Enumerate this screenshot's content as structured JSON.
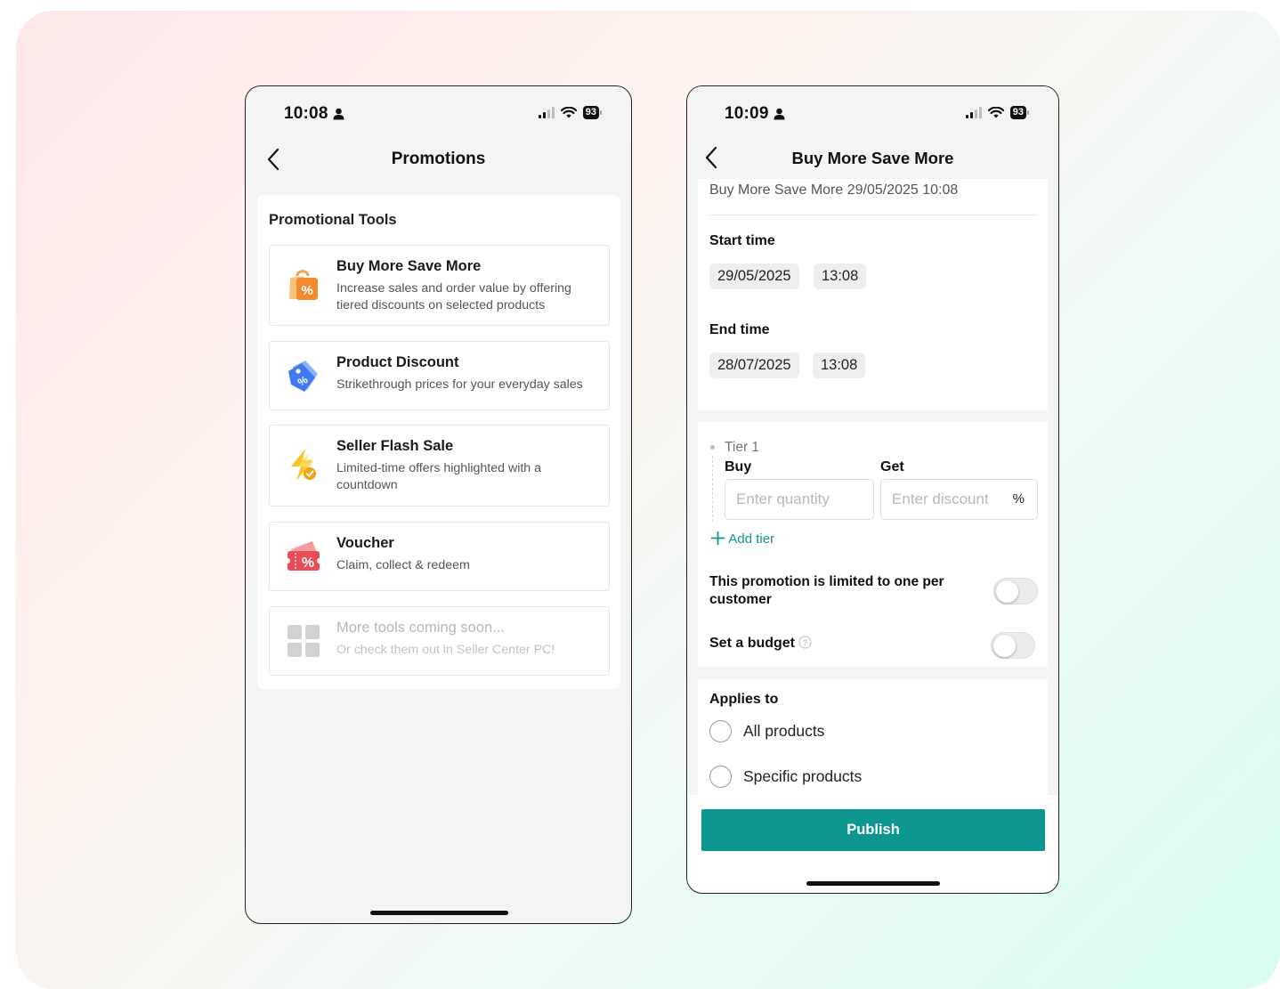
{
  "screen1": {
    "status_time": "10:08",
    "battery": "93",
    "title": "Promotions",
    "section_title": "Promotional Tools",
    "tools": [
      {
        "name": "Buy More Save More",
        "desc": "Increase sales and order value by offering tiered discounts on selected products",
        "icon": "shopping-bag-percent-icon"
      },
      {
        "name": "Product Discount",
        "desc": "Strikethrough prices for your everyday sales",
        "icon": "price-tag-percent-icon"
      },
      {
        "name": "Seller Flash Sale",
        "desc": "Limited-time offers highlighted with a countdown",
        "icon": "lightning-check-icon"
      },
      {
        "name": "Voucher",
        "desc": "Claim, collect & redeem",
        "icon": "voucher-ticket-icon"
      },
      {
        "name": "More tools coming soon...",
        "desc": "Or check them out in Seller Center PC!",
        "icon": "grid-icon"
      }
    ]
  },
  "screen2": {
    "status_time": "10:09",
    "battery": "93",
    "title": "Buy More Save More",
    "promo_name": "Buy More Save More 29/05/2025 10:08",
    "start_label": "Start time",
    "start_date": "29/05/2025",
    "start_time": "13:08",
    "end_label": "End time",
    "end_date": "28/07/2025",
    "end_time": "13:08",
    "tier_label": "Tier 1",
    "buy_label": "Buy",
    "get_label": "Get",
    "quantity_placeholder": "Enter quantity",
    "discount_placeholder": "Enter discount",
    "percent": "%",
    "add_tier": "Add tier",
    "limit_label": "This promotion is limited to one per customer",
    "budget_label": "Set a budget",
    "applies_label": "Applies to",
    "option_all": "All products",
    "option_specific": "Specific products",
    "publish": "Publish"
  },
  "colors": {
    "accent": "#0e9690",
    "add_tier_text": "#0e9690"
  }
}
